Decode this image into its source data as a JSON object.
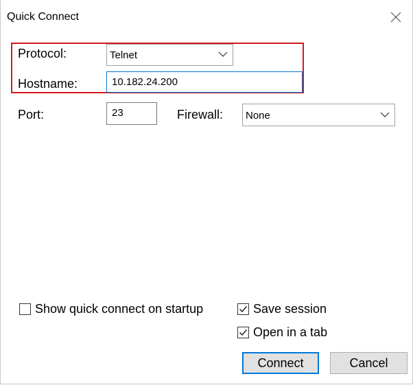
{
  "window": {
    "title": "Quick Connect",
    "close_icon": "close-icon"
  },
  "form": {
    "protocol_label": "Protocol:",
    "protocol_value": "Telnet",
    "hostname_label": "Hostname:",
    "hostname_value": "10.182.24.200",
    "port_label": "Port:",
    "port_value": "23",
    "firewall_label": "Firewall:",
    "firewall_value": "None"
  },
  "options": {
    "show_on_startup_label": "Show quick connect on startup",
    "show_on_startup_checked": false,
    "save_session_label": "Save session",
    "save_session_checked": true,
    "open_in_tab_label": "Open in a tab",
    "open_in_tab_checked": true
  },
  "buttons": {
    "connect_label": "Connect",
    "cancel_label": "Cancel"
  },
  "colors": {
    "highlight_border": "#d2191c",
    "focus_accent": "#0078d7"
  }
}
